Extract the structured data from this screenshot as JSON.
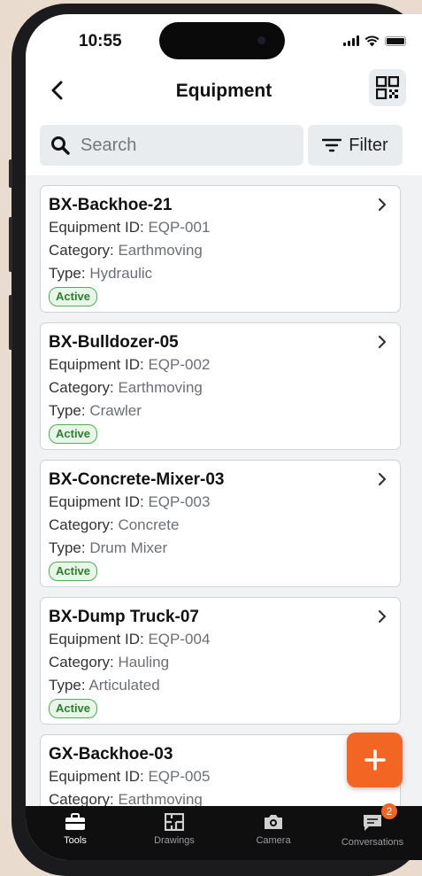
{
  "status": {
    "time": "10:55"
  },
  "header": {
    "title": "Equipment"
  },
  "search": {
    "placeholder": "Search",
    "filter_label": "Filter"
  },
  "labels": {
    "equipment_id": "Equipment ID:",
    "category": "Category:",
    "type": "Type:"
  },
  "equipment": [
    {
      "name": "BX-Backhoe-21",
      "id": "EQP-001",
      "category": "Earthmoving",
      "type": "Hydraulic",
      "status": "Active"
    },
    {
      "name": "BX-Bulldozer-05",
      "id": "EQP-002",
      "category": "Earthmoving",
      "type": "Crawler",
      "status": "Active"
    },
    {
      "name": "BX-Concrete-Mixer-03",
      "id": "EQP-003",
      "category": "Concrete",
      "type": "Drum Mixer",
      "status": "Active"
    },
    {
      "name": "BX-Dump Truck-07",
      "id": "EQP-004",
      "category": "Hauling",
      "type": "Articulated",
      "status": "Active"
    },
    {
      "name": "GX-Backhoe-03",
      "id": "EQP-005",
      "category": "Earthmoving"
    }
  ],
  "tabbar": {
    "tabs": [
      {
        "label": "Tools",
        "icon": "toolbox-icon",
        "active": true
      },
      {
        "label": "Drawings",
        "icon": "floorplan-icon"
      },
      {
        "label": "Camera",
        "icon": "camera-icon"
      },
      {
        "label": "Conversations",
        "icon": "chat-icon",
        "badge": "2"
      }
    ]
  },
  "colors": {
    "accent": "#f26522",
    "status_active": "#2e7d32",
    "tabbar_bg": "#0f0f10"
  }
}
